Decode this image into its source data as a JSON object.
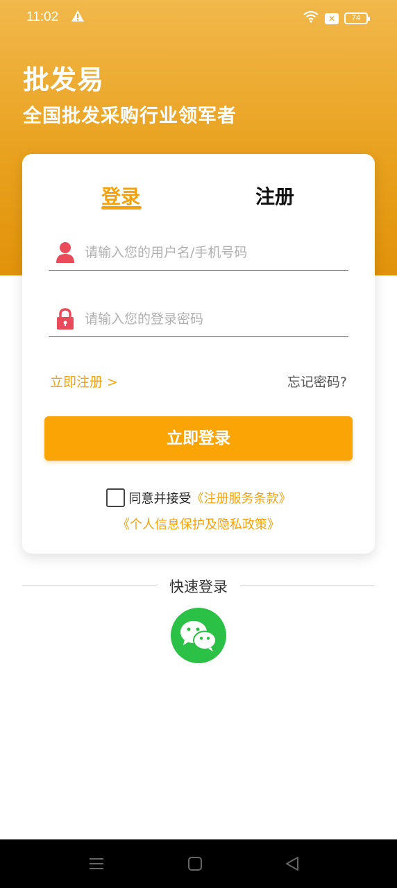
{
  "status_bar": {
    "time": "11:02",
    "battery": "74",
    "icons": [
      "warning-icon",
      "wifi-icon",
      "sim-off-icon",
      "battery-icon"
    ]
  },
  "header": {
    "app_name": "批发易",
    "slogan": "全国批发采购行业领军者"
  },
  "tabs": {
    "login": "登录",
    "register": "注册",
    "active": "login"
  },
  "form": {
    "username_placeholder": "请输入您的用户名/手机号码",
    "password_placeholder": "请输入您的登录密码",
    "username_value": "",
    "password_value": ""
  },
  "links": {
    "register_now": "立即注册 >",
    "forgot_password": "忘记密码?"
  },
  "login_button": "立即登录",
  "agreement": {
    "checked": false,
    "text": "同意并接受",
    "terms": "《注册服务条款》",
    "privacy": "《个人信息保护及隐私政策》"
  },
  "quick_login": {
    "label": "快速登录",
    "options": [
      "wechat-icon"
    ]
  },
  "colors": {
    "accent": "#f3a20e",
    "button": "#fba405",
    "header_gradient_top": "#f1b84b",
    "header_gradient_bottom": "#e1920a",
    "wechat_green": "#2bc046",
    "icon_red": "#e94b5a"
  }
}
